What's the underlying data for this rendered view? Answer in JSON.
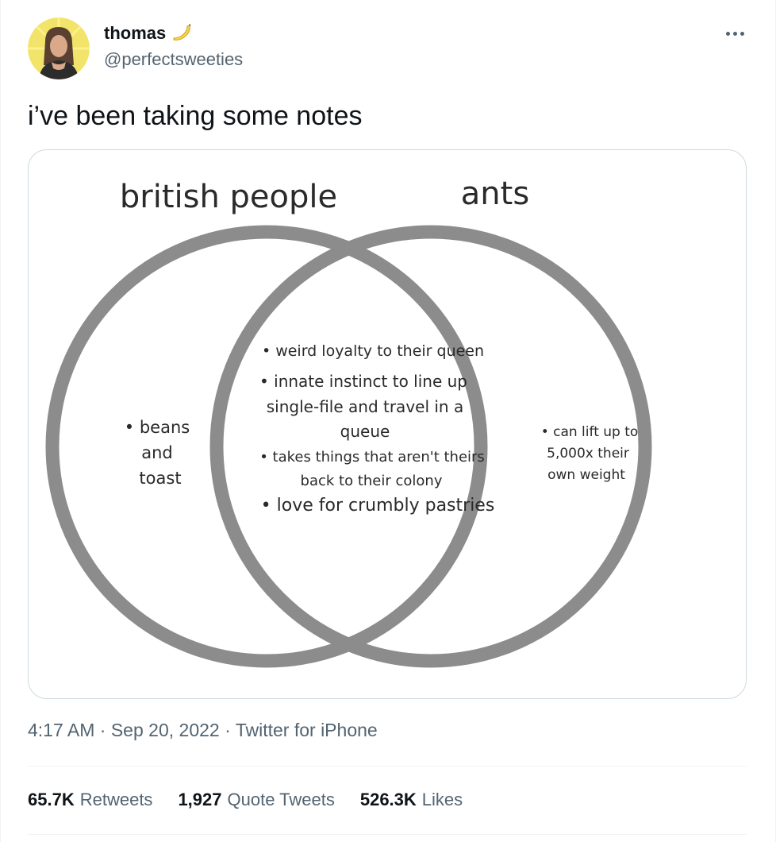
{
  "author": {
    "display_name": "thomas",
    "handle": "@perfectsweeties",
    "badge_icon": "banana-icon"
  },
  "tweet": {
    "text": "i’ve been taking some notes"
  },
  "venn": {
    "left_title": "british people",
    "right_title": "ants",
    "left_only": [
      "• beans",
      "and",
      "toast"
    ],
    "overlap": [
      "• weird loyalty to their queen",
      "• innate instinct to line up",
      "single-file and travel in a",
      "queue",
      "• takes things that aren't theirs",
      "back to their colony",
      "• love for crumbly pastries"
    ],
    "right_only": [
      "• can lift up to",
      "5,000x their",
      "own weight"
    ],
    "circle_color": "#8c8c8c"
  },
  "meta": {
    "time": "4:17 AM",
    "sep1": " · ",
    "date": "Sep 20, 2022",
    "sep2": " · ",
    "source": "Twitter for iPhone"
  },
  "stats": {
    "retweets_count": "65.7K",
    "retweets_label": "Retweets",
    "quotes_count": "1,927",
    "quotes_label": "Quote Tweets",
    "likes_count": "526.3K",
    "likes_label": "Likes"
  },
  "colors": {
    "text_primary": "#0f1419",
    "text_secondary": "#536471",
    "border": "#cfd9de"
  }
}
